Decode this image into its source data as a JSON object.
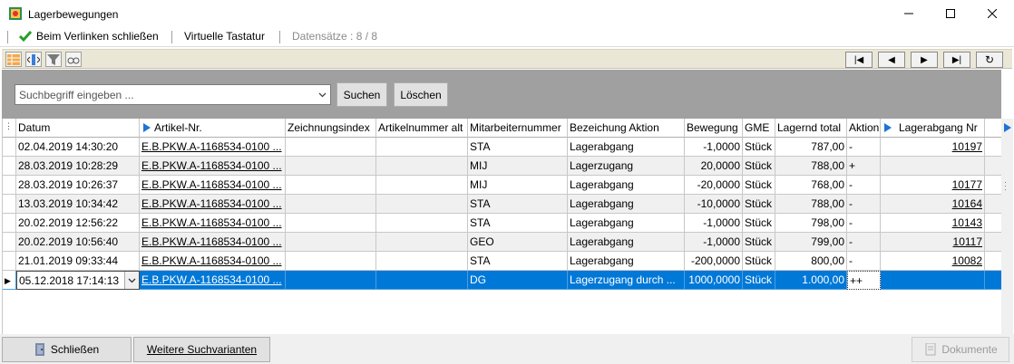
{
  "window": {
    "title": "Lagerbewegungen"
  },
  "menubar": {
    "close_on_link": "Beim Verlinken schließen",
    "virtual_keyboard": "Virtuelle Tastatur",
    "records": "Datensätze : 8 / 8"
  },
  "search": {
    "placeholder": "Suchbegriff eingeben ...",
    "search_label": "Suchen",
    "clear_label": "Löschen"
  },
  "columns": [
    "Datum",
    "Artikel-Nr.",
    "Zeichnungsindex",
    "Artikelnummer alt",
    "Mitarbeiternummer",
    "Bezeichung Aktion",
    "Bewegung",
    "GME",
    "Lagernd total",
    "Aktion",
    "Lagerabgang Nr"
  ],
  "rows": [
    {
      "datum": "02.04.2019 14:30:20",
      "artikel": "E.B.PKW.A-1168534-0100 ...",
      "zeichnung": "",
      "alt": "",
      "mitarbeiter": "STA",
      "bezeichnung": "Lagerabgang",
      "bewegung": "-1,0000",
      "gme": "Stück",
      "lagernd": "787,00",
      "aktion": "-",
      "abgang": "10197"
    },
    {
      "datum": "28.03.2019 10:28:29",
      "artikel": "E.B.PKW.A-1168534-0100 ...",
      "zeichnung": "",
      "alt": "",
      "mitarbeiter": "MIJ",
      "bezeichnung": "Lagerzugang",
      "bewegung": "20,0000",
      "gme": "Stück",
      "lagernd": "788,00",
      "aktion": "+",
      "abgang": ""
    },
    {
      "datum": "28.03.2019 10:26:37",
      "artikel": "E.B.PKW.A-1168534-0100 ...",
      "zeichnung": "",
      "alt": "",
      "mitarbeiter": "MIJ",
      "bezeichnung": "Lagerabgang",
      "bewegung": "-20,0000",
      "gme": "Stück",
      "lagernd": "768,00",
      "aktion": "-",
      "abgang": "10177"
    },
    {
      "datum": "13.03.2019 10:34:42",
      "artikel": "E.B.PKW.A-1168534-0100 ...",
      "zeichnung": "",
      "alt": "",
      "mitarbeiter": "STA",
      "bezeichnung": "Lagerabgang",
      "bewegung": "-10,0000",
      "gme": "Stück",
      "lagernd": "788,00",
      "aktion": "-",
      "abgang": "10164"
    },
    {
      "datum": "20.02.2019 12:56:22",
      "artikel": "E.B.PKW.A-1168534-0100 ...",
      "zeichnung": "",
      "alt": "",
      "mitarbeiter": "STA",
      "bezeichnung": "Lagerabgang",
      "bewegung": "-1,0000",
      "gme": "Stück",
      "lagernd": "798,00",
      "aktion": "-",
      "abgang": "10143"
    },
    {
      "datum": "20.02.2019 10:56:40",
      "artikel": "E.B.PKW.A-1168534-0100 ...",
      "zeichnung": "",
      "alt": "",
      "mitarbeiter": "GEO",
      "bezeichnung": "Lagerabgang",
      "bewegung": "-1,0000",
      "gme": "Stück",
      "lagernd": "799,00",
      "aktion": "-",
      "abgang": "10117"
    },
    {
      "datum": "21.01.2019 09:33:44",
      "artikel": "E.B.PKW.A-1168534-0100 ...",
      "zeichnung": "",
      "alt": "",
      "mitarbeiter": "STA",
      "bezeichnung": "Lagerabgang",
      "bewegung": "-200,0000",
      "gme": "Stück",
      "lagernd": "800,00",
      "aktion": "-",
      "abgang": "10082"
    },
    {
      "datum": "05.12.2018 17:14:13",
      "artikel": "E.B.PKW.A-1168534-0100 ...",
      "zeichnung": "",
      "alt": "",
      "mitarbeiter": "DG",
      "bezeichnung": "Lagerzugang durch ...",
      "bewegung": "1000,0000",
      "gme": "Stück",
      "lagernd": "1.000,00",
      "aktion": "++",
      "abgang": ""
    }
  ],
  "footer": {
    "close_label": "Schließen",
    "more_search_label": "Weitere Suchvarianten",
    "documents_label": "Dokumente"
  },
  "colors": {
    "selection": "#0078d7",
    "panel": "#a0a0a0",
    "link_arrow": "#1f73d6"
  }
}
